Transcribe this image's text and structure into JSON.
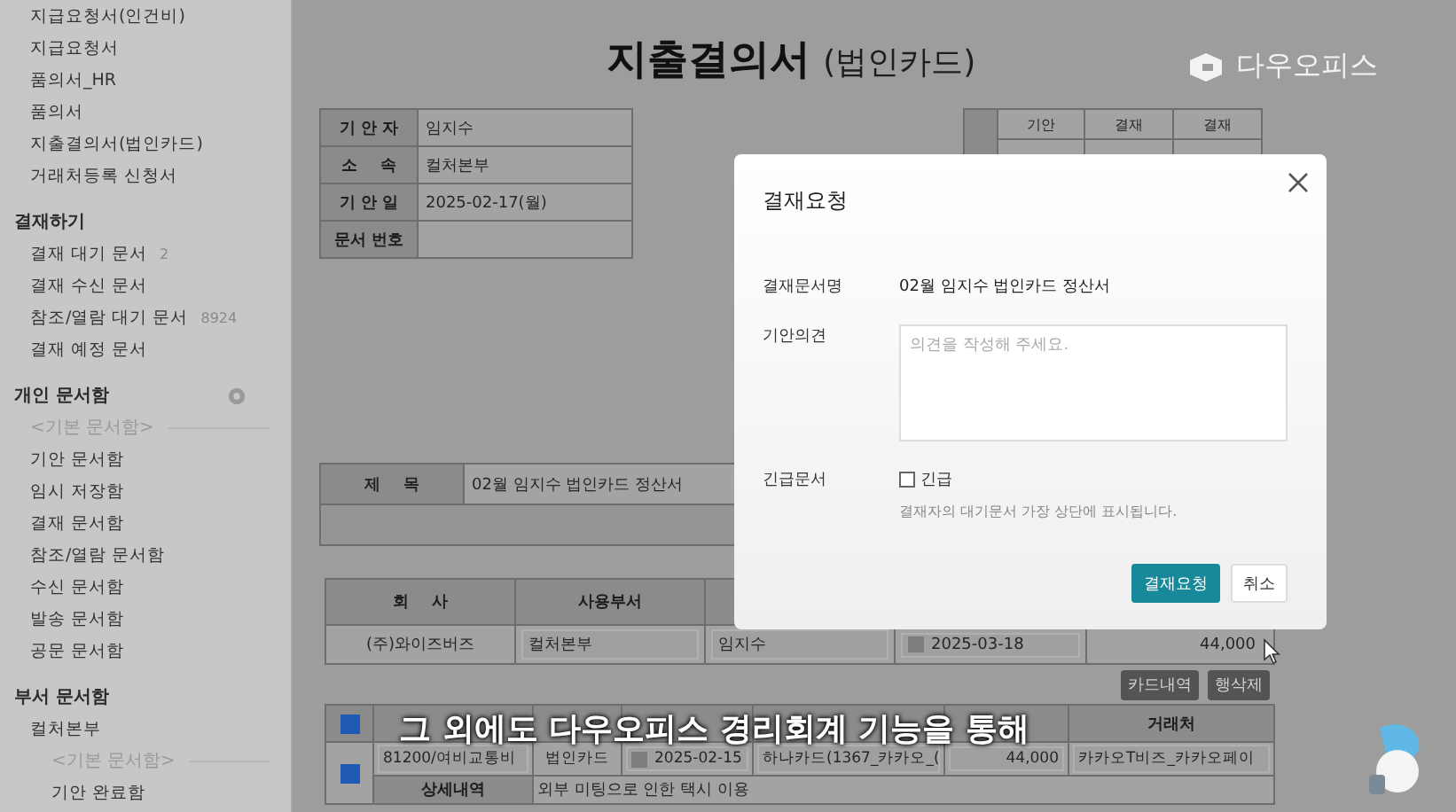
{
  "sidebar": {
    "groups": [
      {
        "items": [
          {
            "kind": "link",
            "label": "지급요청서(인건비)"
          },
          {
            "kind": "link",
            "label": "지급요청서"
          },
          {
            "kind": "link",
            "label": "품의서_HR"
          },
          {
            "kind": "link",
            "label": "품의서"
          },
          {
            "kind": "link",
            "label": "지출결의서(법인카드)"
          },
          {
            "kind": "link",
            "label": "거래처등록 신청서"
          }
        ]
      },
      {
        "title": "결재하기",
        "items": [
          {
            "kind": "link",
            "label": "결재 대기 문서",
            "count": "2"
          },
          {
            "kind": "link",
            "label": "결재 수신 문서"
          },
          {
            "kind": "link",
            "label": "참조/열람 대기 문서",
            "count": "8924"
          },
          {
            "kind": "link",
            "label": "결재 예정 문서"
          }
        ]
      },
      {
        "title": "개인 문서함",
        "has_settings": true,
        "items": [
          {
            "kind": "divider",
            "label": "<기본 문서함>"
          },
          {
            "kind": "link",
            "label": "기안 문서함"
          },
          {
            "kind": "link",
            "label": "임시 저장함"
          },
          {
            "kind": "link",
            "label": "결재 문서함"
          },
          {
            "kind": "link",
            "label": "참조/열람 문서함"
          },
          {
            "kind": "link",
            "label": "수신 문서함"
          },
          {
            "kind": "link",
            "label": "발송 문서함"
          },
          {
            "kind": "link",
            "label": "공문 문서함"
          }
        ]
      },
      {
        "title": "부서 문서함",
        "items": [
          {
            "kind": "link",
            "label": "컬처본부",
            "children": [
              {
                "kind": "divider",
                "label": "<기본 문서함>"
              },
              {
                "kind": "link",
                "label": "기안 완료함"
              }
            ]
          }
        ]
      }
    ]
  },
  "form": {
    "title": "지출결의서",
    "subtitle": "(법인카드)",
    "info": [
      {
        "label": "기 안 자",
        "value": "임지수"
      },
      {
        "label": "소    속",
        "value": "컬처본부"
      },
      {
        "label": "기 안 일",
        "value": "2025-02-17(월)"
      },
      {
        "label": "문서 번호"
      }
    ],
    "approval": {
      "columns": [
        "기안",
        "결재",
        "결재"
      ]
    },
    "subject": {
      "label": "제    목",
      "value": "02월 임지수 법인카드 정산서"
    },
    "company_table": {
      "columns": [
        "회    사",
        "사용부서"
      ],
      "row": {
        "company": "(주)와이즈버즈",
        "department": "컬처본부",
        "user": "임지수",
        "date": "2025-03-18",
        "amount": "44,000"
      }
    },
    "actions": [
      "카드내역",
      "행삭제"
    ],
    "items_table": {
      "select_all": true,
      "columns": [
        "거래처"
      ],
      "rows": [
        {
          "checked": true,
          "account": "81200/여비교통비",
          "proof": "법인카드",
          "date": "2025-02-15",
          "card": "하나카드(1367_카카오_(",
          "amount": "44,000",
          "vendor": "카카오T비즈_카카오페이",
          "detail_label": "상세내역",
          "detail": "외부 미팅으로 인한 택시 이용"
        }
      ]
    }
  },
  "modal": {
    "title": "결재요청",
    "fields": [
      {
        "kind": "text",
        "label": "결재문서명",
        "value": "02월 임지수 법인카드 정산서"
      },
      {
        "kind": "textarea",
        "label": "기안의견",
        "placeholder": "의견을 작성해 주세요."
      },
      {
        "kind": "checkbox",
        "label": "긴급문서",
        "option": "긴급",
        "checked": false,
        "hint": "결재자의 대기문서 가장 상단에 표시됩니다."
      }
    ],
    "buttons": [
      {
        "label": "결재요청",
        "primary": true
      },
      {
        "label": "취소",
        "primary": false
      }
    ]
  },
  "brand": {
    "name": "다우오피스"
  },
  "caption": "그 외에도 다우오피스 경리회계 기능을 통해"
}
